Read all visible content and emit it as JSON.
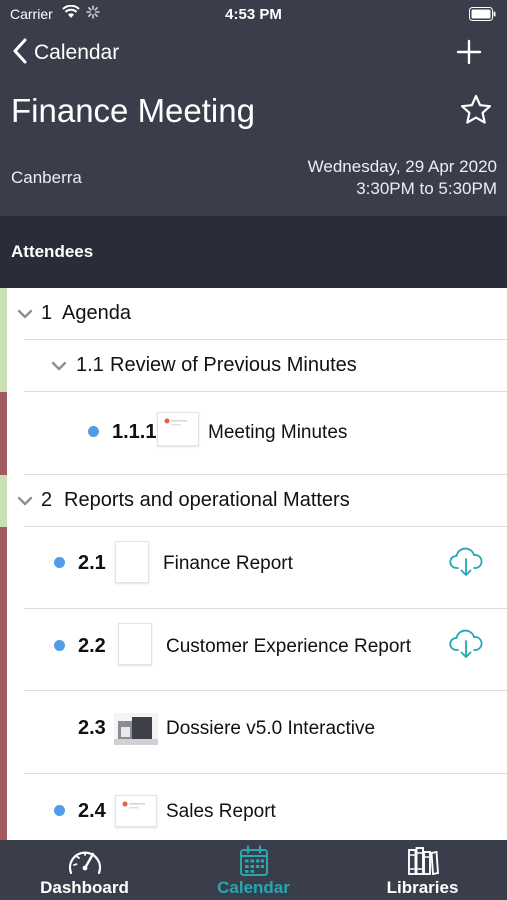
{
  "status_bar": {
    "carrier": "Carrier",
    "time": "4:53 PM"
  },
  "nav": {
    "back_label": "Calendar"
  },
  "meeting": {
    "title": "Finance Meeting",
    "location": "Canberra",
    "date": "Wednesday, 29 Apr 2020",
    "time_range": "3:30PM to 5:30PM"
  },
  "attendees_label": "Attendees",
  "agenda": {
    "section1": {
      "number": "1",
      "title": "Agenda"
    },
    "sub1_1": {
      "number": "1.1",
      "title": "Review of Previous Minutes"
    },
    "item1_1_1": {
      "number": "1.1.1",
      "label": "Meeting Minutes"
    },
    "section2": {
      "number": "2",
      "title": "Reports and operational Matters"
    },
    "item2_1": {
      "number": "2.1",
      "label": "Finance Report"
    },
    "item2_2": {
      "number": "2.2",
      "label": "Customer Experience Report"
    },
    "item2_3": {
      "number": "2.3",
      "label": "Dossiere v5.0 Interactive"
    },
    "item2_4": {
      "number": "2.4",
      "label": "Sales Report"
    }
  },
  "tabs": [
    {
      "label": "Dashboard",
      "icon": "gauge-icon"
    },
    {
      "label": "Calendar",
      "icon": "calendar-icon"
    },
    {
      "label": "Libraries",
      "icon": "books-icon"
    }
  ],
  "colors": {
    "header": "#3a3e4b",
    "attendees_bar": "#2a2d37",
    "accent": "#27a7b0",
    "unread_dot": "#4f9ce9",
    "stripe_green": "#c8e0b4",
    "stripe_red": "#a35b5f"
  }
}
